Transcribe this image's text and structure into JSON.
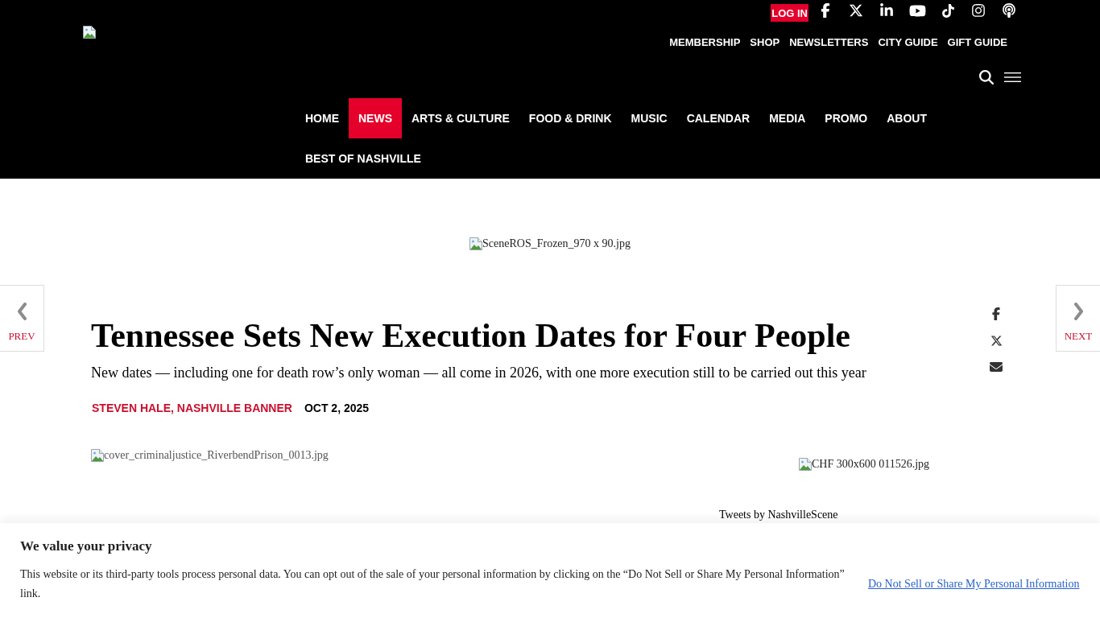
{
  "header": {
    "login": "LOG IN",
    "utility_links": [
      "MEMBERSHIP",
      "SHOP",
      "NEWSLETTERS",
      "CITY GUIDE",
      "GIFT GUIDE"
    ],
    "main_nav": [
      {
        "label": "HOME",
        "selected": false
      },
      {
        "label": "NEWS",
        "selected": true
      },
      {
        "label": "ARTS & CULTURE",
        "selected": false
      },
      {
        "label": "FOOD & DRINK",
        "selected": false
      },
      {
        "label": "MUSIC",
        "selected": false
      },
      {
        "label": "CALENDAR",
        "selected": false
      },
      {
        "label": "MEDIA",
        "selected": false
      },
      {
        "label": "PROMO",
        "selected": false
      },
      {
        "label": "ABOUT",
        "selected": false
      },
      {
        "label": "BEST OF NASHVILLE",
        "selected": false
      }
    ]
  },
  "top_ad": {
    "alt": "SceneROS_Frozen_970 x 90.jpg"
  },
  "pager": {
    "prev": "PREV",
    "next": "NEXT"
  },
  "article": {
    "title": "Tennessee Sets New Execution Dates for Four People",
    "subtitle": "New dates — including one for death row’s only woman — all come in 2026, with one more execution still to be carried out this year",
    "byline": "STEVEN HALE, NASHVILLE BANNER",
    "date": "OCT 2, 2025",
    "image_alt": "cover_criminaljustice_RiverbendPrison_0013.jpg"
  },
  "sidebar": {
    "ad_alt": "CHF 300x600 011526.jpg",
    "tweets_label": "Tweets by NashvilleScene"
  },
  "privacy_banner": {
    "title": "We value your privacy",
    "text": "This website or its third-party tools process personal data. You can opt out of the sale of your personal information by clicking on the “Do Not Sell or Share My Personal Information” link.",
    "link": "Do Not Sell or Share My Personal Information"
  }
}
